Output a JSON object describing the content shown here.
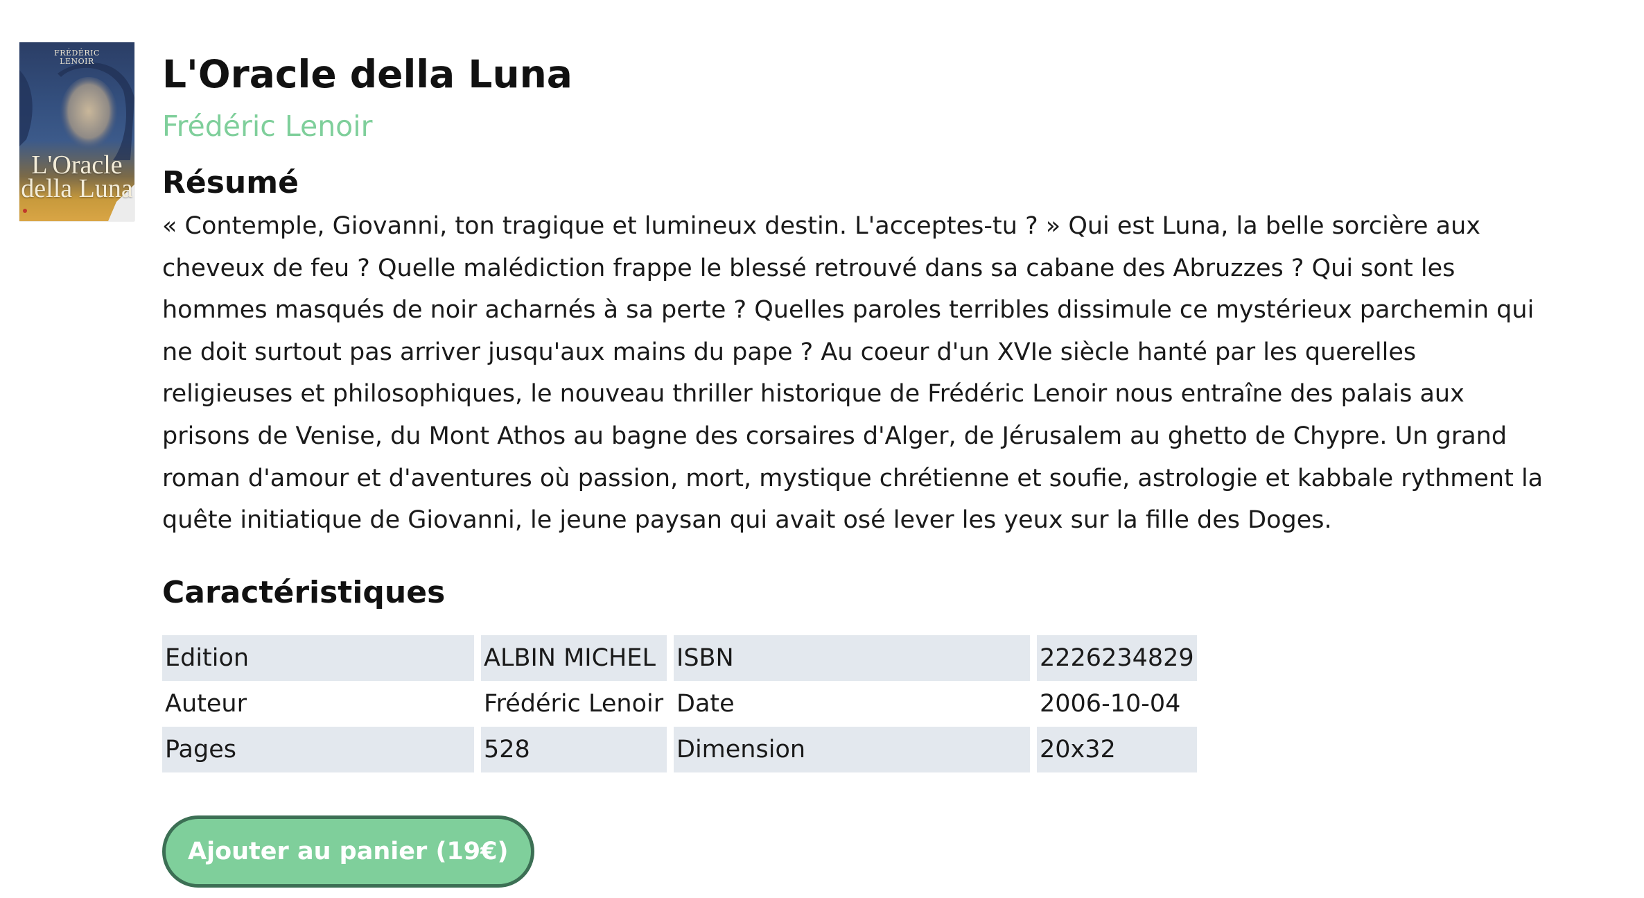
{
  "book": {
    "title": "L'Oracle della Luna",
    "author": "Frédéric Lenoir",
    "cover": {
      "author_text": "FRÉDÉRIC\nLENOIR",
      "title_text": "L'Oracle\ndella Luna"
    }
  },
  "summary": {
    "heading": "Résumé",
    "lines": [
      "« Contemple, Giovanni, ton tragique et lumineux destin. L'acceptes-tu ? » Qui est Luna, la belle sorcière aux",
      "cheveux de feu ? Quelle malédiction frappe le blessé retrouvé dans sa cabane des Abruzzes ? Qui sont les",
      "hommes masqués de noir acharnés à sa perte ? Quelles paroles terribles dissimule ce mystérieux parchemin qui",
      "ne doit surtout pas arriver jusqu'aux mains du pape ? Au coeur d'un XVIe siècle hanté par les querelles",
      "religieuses et philosophiques, le nouveau thriller historique de Frédéric Lenoir nous entraîne des palais aux",
      "prisons de Venise, du Mont Athos au bagne des corsaires d'Alger, de Jérusalem au ghetto de Chypre. Un grand",
      "roman d'amour et d'aventures où passion, mort, mystique chrétienne et soufie, astrologie et kabbale rythment la",
      "quête initiatique de Giovanni, le jeune paysan qui avait osé lever les yeux sur la fille des Doges."
    ]
  },
  "specs": {
    "heading": "Caractéristiques",
    "rows": [
      {
        "k1": "Edition",
        "v1": "ALBIN MICHEL",
        "k2": "ISBN",
        "v2": "2226234829"
      },
      {
        "k1": "Auteur",
        "v1": "Frédéric Lenoir",
        "k2": "Date",
        "v2": "2006-10-04"
      },
      {
        "k1": "Pages",
        "v1": "528",
        "k2": "Dimension",
        "v2": "20x32"
      }
    ]
  },
  "cart": {
    "label": "Ajouter au panier (19€)"
  },
  "colors": {
    "accent": "#7fcf9b",
    "button_border": "#3c6f54",
    "stripe": "#e3e8ee"
  }
}
